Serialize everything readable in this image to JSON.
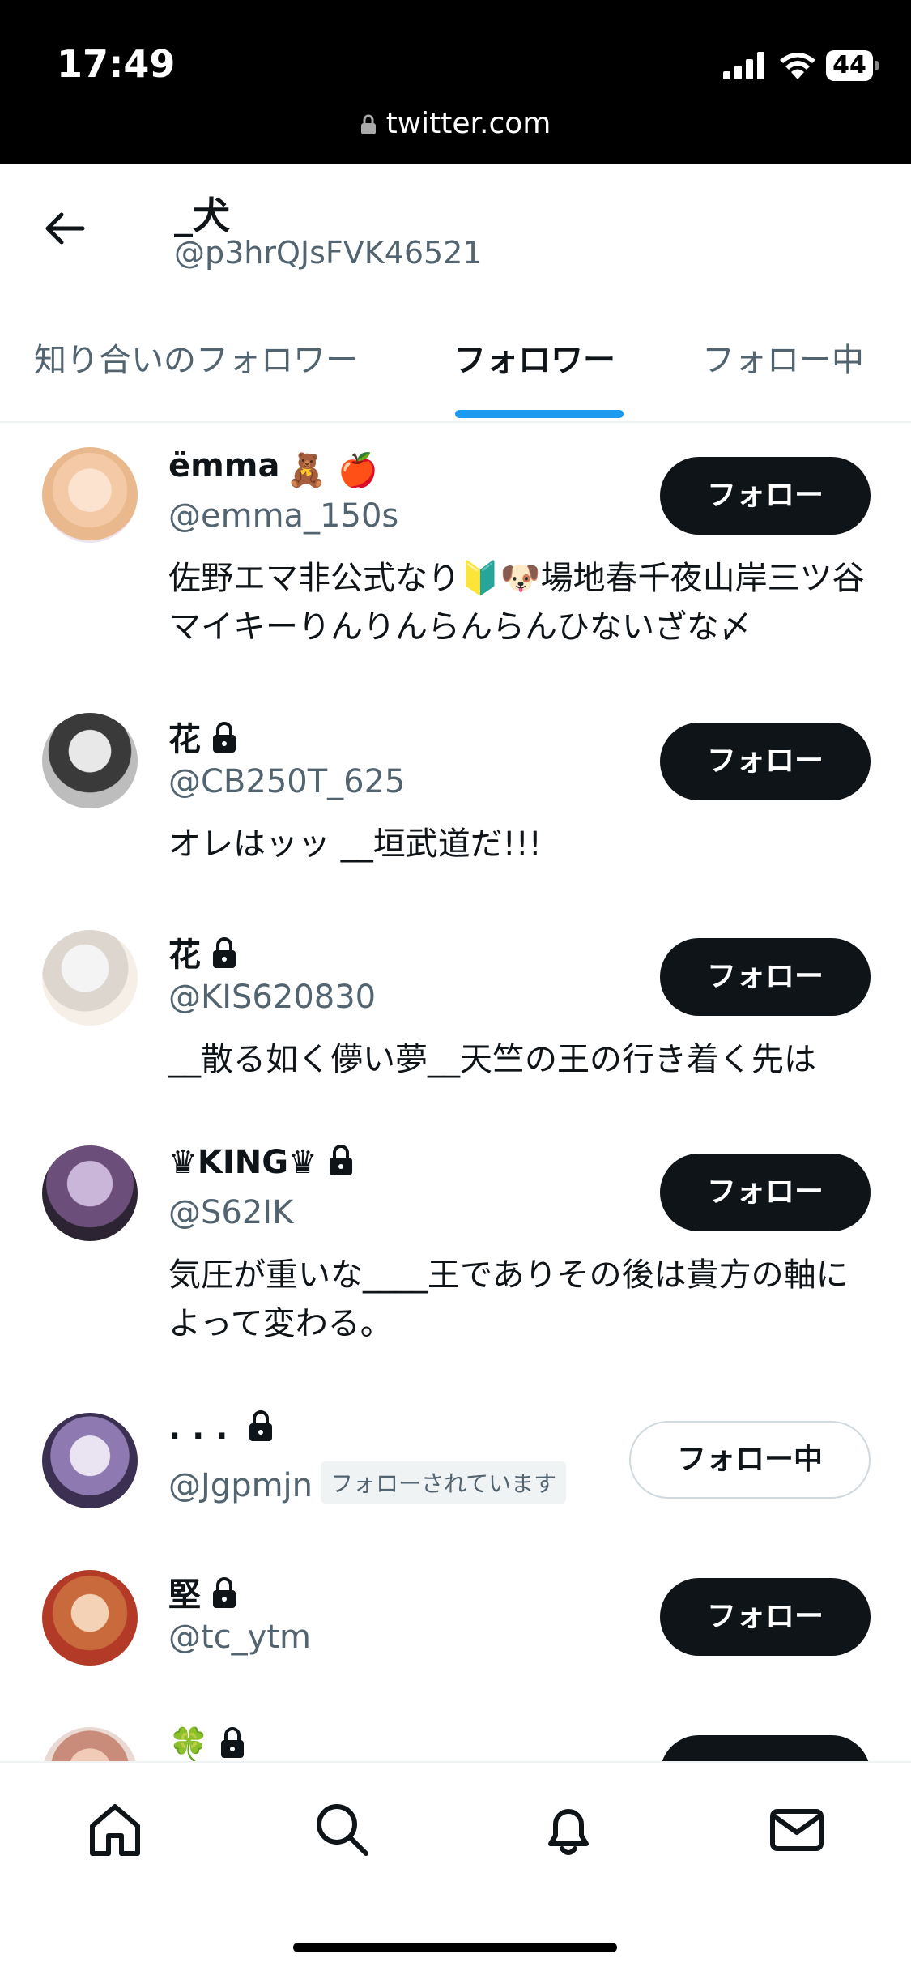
{
  "status_bar": {
    "time": "17:49",
    "battery": "44",
    "url": "twitter.com"
  },
  "header": {
    "name": "_犬",
    "handle": "@p3hrQJsFVK46521"
  },
  "tabs": [
    {
      "label": "知り合いのフォロワー",
      "active": false
    },
    {
      "label": "フォロワー",
      "active": true
    },
    {
      "label": "フォロー中",
      "active": false
    }
  ],
  "users": [
    {
      "name": "ëmma",
      "name_emoji": "🧸 🍎",
      "protected": false,
      "handle": "@emma_150s",
      "bio": "佐野エマ非公式なり🔰🐶場地春千夜山岸三ツ谷マイキーりんりんらんらんひないざな〆",
      "button": "フォロー"
    },
    {
      "name": "花",
      "protected": true,
      "handle": "@CB250T_625",
      "bio": "オレはッッ __垣武道だ!!!",
      "button": "フォロー"
    },
    {
      "name": "花",
      "protected": true,
      "handle": "@KIS620830",
      "bio": "__散る如く儚い夢__天竺の王の行き着く先は",
      "button": "フォロー"
    },
    {
      "name": "♛KING♛",
      "protected": true,
      "handle": "@S62IK",
      "bio": "気圧が重いな____王でありその後は貴方の軸によって変わる。",
      "button": "フォロー"
    },
    {
      "name": ". . .",
      "protected": true,
      "handle": "@Jgpmjn",
      "badge": "フォローされています",
      "bio": "",
      "button": "フォロー中"
    },
    {
      "name": "堅",
      "protected": true,
      "handle": "@tc_ytm",
      "bio": "",
      "button": "フォロー"
    },
    {
      "name": "🍀",
      "protected": true,
      "handle": "",
      "bio": "",
      "button": ""
    }
  ],
  "bottom_nav": [
    "home-icon",
    "search-icon",
    "notifications-icon",
    "messages-icon"
  ]
}
